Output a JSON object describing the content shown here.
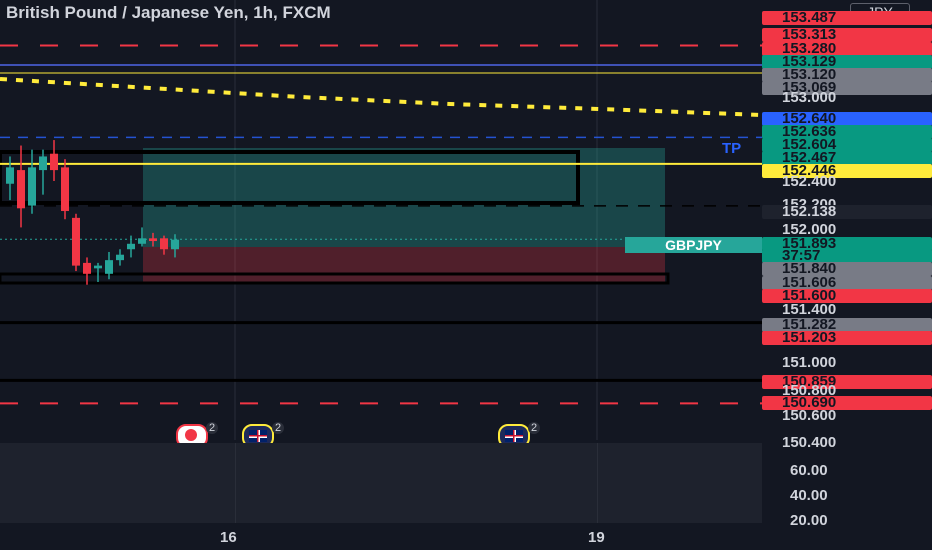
{
  "title": "British Pound / Japanese Yen, 1h, FXCM",
  "currency_button": "JPY",
  "symbol_tag": "GBPJPY",
  "tp_marker": "TP",
  "time_labels": [
    "16",
    "19"
  ],
  "colors": {
    "background": "#131722",
    "up": "#26a69a",
    "down": "#f23645",
    "highlight": "#ffeb3b",
    "blue_line": "#2962ff"
  },
  "price_axis": [
    {
      "text": "153.487",
      "kind": "tag",
      "bg": "#f23645",
      "fg": "#131722"
    },
    {
      "text": "153.313",
      "kind": "tag",
      "bg": "#f23645",
      "fg": "#131722"
    },
    {
      "text": "153.280",
      "kind": "tag",
      "bg": "#f23645",
      "fg": "#131722"
    },
    {
      "text": "153.129",
      "kind": "tag",
      "bg": "#089981",
      "fg": "#131722"
    },
    {
      "text": "153.120",
      "kind": "tag",
      "bg": "#787b86",
      "fg": "#131722"
    },
    {
      "text": "153.069",
      "kind": "tag",
      "bg": "#787b86",
      "fg": "#131722"
    },
    {
      "text": "153.000",
      "kind": "plain"
    },
    {
      "text": "152.640",
      "kind": "tag",
      "bg": "#2962ff",
      "fg": "#131722"
    },
    {
      "text": "152.636",
      "kind": "tag",
      "bg": "#089981",
      "fg": "#131722"
    },
    {
      "text": "152.604",
      "kind": "tag",
      "bg": "#089981",
      "fg": "#131722"
    },
    {
      "text": "152.467",
      "kind": "tag",
      "bg": "#089981",
      "fg": "#131722"
    },
    {
      "text": "152.446",
      "kind": "tag",
      "bg": "#ffeb3b",
      "fg": "#131722"
    },
    {
      "text": "152.400",
      "kind": "plain"
    },
    {
      "text": "152.200",
      "kind": "plain"
    },
    {
      "text": "152.138",
      "kind": "tag",
      "bg": "#1e222d",
      "fg": "#d1d4dc"
    },
    {
      "text": "152.000",
      "kind": "plain"
    },
    {
      "text": "151.893",
      "kind": "tag",
      "bg": "#089981",
      "fg": "#131722"
    },
    {
      "text": "37:57",
      "kind": "tag",
      "bg": "#089981",
      "fg": "#131722"
    },
    {
      "text": "151.840",
      "kind": "tag",
      "bg": "#787b86",
      "fg": "#131722"
    },
    {
      "text": "151.606",
      "kind": "tag",
      "bg": "#787b86",
      "fg": "#131722"
    },
    {
      "text": "151.600",
      "kind": "tag",
      "bg": "#f23645",
      "fg": "#131722"
    },
    {
      "text": "151.400",
      "kind": "plain"
    },
    {
      "text": "151.282",
      "kind": "tag",
      "bg": "#787b86",
      "fg": "#131722"
    },
    {
      "text": "151.203",
      "kind": "tag",
      "bg": "#f23645",
      "fg": "#131722"
    },
    {
      "text": "151.000",
      "kind": "plain"
    },
    {
      "text": "150.859",
      "kind": "tag",
      "bg": "#f23645",
      "fg": "#131722"
    },
    {
      "text": "150.800",
      "kind": "plain"
    },
    {
      "text": "150.690",
      "kind": "tag",
      "bg": "#f23645",
      "fg": "#131722"
    },
    {
      "text": "150.600",
      "kind": "plain"
    },
    {
      "text": "150.400",
      "kind": "plain"
    }
  ],
  "indicator_axis": [
    "60.00",
    "40.00",
    "20.00"
  ],
  "event_badges": [
    {
      "icon": "record-icon",
      "count": "2"
    },
    {
      "icon": "uk-flag-icon",
      "count": "2"
    },
    {
      "icon": "uk-flag-icon",
      "count": "2"
    }
  ],
  "chart_data": {
    "type": "candlestick",
    "y_range": [
      150.4,
      153.5
    ],
    "candles": [
      {
        "o": 152.3,
        "h": 152.5,
        "l": 152.18,
        "c": 152.42
      },
      {
        "o": 152.4,
        "h": 152.58,
        "l": 151.98,
        "c": 152.12
      },
      {
        "o": 152.14,
        "h": 152.55,
        "l": 152.08,
        "c": 152.42
      },
      {
        "o": 152.4,
        "h": 152.55,
        "l": 152.22,
        "c": 152.5
      },
      {
        "o": 152.52,
        "h": 152.62,
        "l": 152.32,
        "c": 152.4
      },
      {
        "o": 152.42,
        "h": 152.48,
        "l": 152.04,
        "c": 152.1
      },
      {
        "o": 152.05,
        "h": 152.08,
        "l": 151.66,
        "c": 151.7
      },
      {
        "o": 151.72,
        "h": 151.76,
        "l": 151.56,
        "c": 151.64
      },
      {
        "o": 151.68,
        "h": 151.72,
        "l": 151.58,
        "c": 151.7
      },
      {
        "o": 151.64,
        "h": 151.8,
        "l": 151.6,
        "c": 151.74
      },
      {
        "o": 151.74,
        "h": 151.82,
        "l": 151.7,
        "c": 151.78
      },
      {
        "o": 151.82,
        "h": 151.92,
        "l": 151.76,
        "c": 151.86
      },
      {
        "o": 151.86,
        "h": 151.98,
        "l": 151.84,
        "c": 151.9
      },
      {
        "o": 151.9,
        "h": 151.94,
        "l": 151.84,
        "c": 151.88
      },
      {
        "o": 151.9,
        "h": 151.92,
        "l": 151.78,
        "c": 151.82
      },
      {
        "o": 151.82,
        "h": 151.93,
        "l": 151.76,
        "c": 151.89
      }
    ],
    "levels": {
      "red_dashed": [
        153.313,
        150.69
      ],
      "blue_solid": 153.129,
      "blue_dashed": 152.64,
      "yellow_line": 152.446,
      "black_dashed": 152.138,
      "black_solid": [
        151.282,
        150.859
      ]
    }
  }
}
